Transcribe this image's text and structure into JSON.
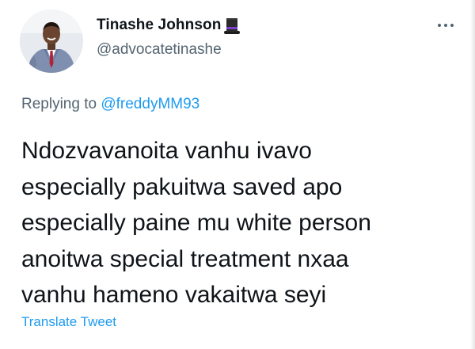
{
  "author": {
    "display_name": "Tinashe Johnson",
    "handle": "@advocatetinashe",
    "name_emoji": "top-hat-icon"
  },
  "reply": {
    "prefix": "Replying to ",
    "mention": "@freddyMM93"
  },
  "tweet": {
    "text": "Ndozvavanoita vanhu ivavo\nespecially pakuitwa saved apo\nespecially paine mu white person\nanoitwa special treatment nxaa\nvanhu hameno vakaitwa seyi"
  },
  "actions": {
    "translate_label": "Translate Tweet",
    "more_icon": "more-options-icon"
  },
  "colors": {
    "text_primary": "#0f1419",
    "text_secondary": "#536471",
    "link": "#1d9bf0"
  }
}
